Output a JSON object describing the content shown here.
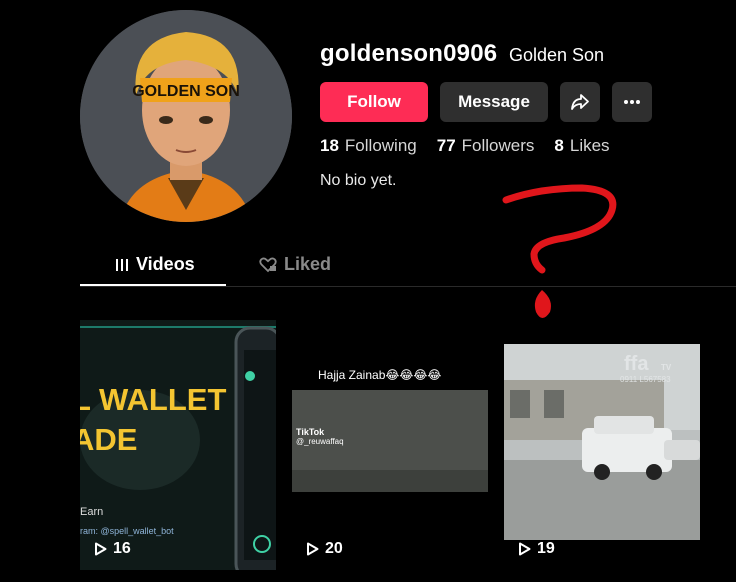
{
  "profile": {
    "username": "goldenson0906",
    "nickname": "Golden Son",
    "avatar_text": "GOLDEN SON",
    "bio": "No bio yet."
  },
  "actions": {
    "follow_label": "Follow",
    "message_label": "Message",
    "share_icon": "share-arrow-icon",
    "more_icon": "more-dots-icon"
  },
  "stats": [
    {
      "num": "18",
      "label": "Following"
    },
    {
      "num": "77",
      "label": "Followers"
    },
    {
      "num": "8",
      "label": "Likes"
    }
  ],
  "tabs": [
    {
      "label": "Videos",
      "icon": "grid-bars-icon",
      "active": true
    },
    {
      "label": "Liked",
      "icon": "heart-lock-icon",
      "active": false
    }
  ],
  "videos": [
    {
      "views": "16",
      "text_lines": [
        "L WALLET",
        "ADE"
      ],
      "earn": "Earn",
      "link": "ram: @spell_wallet_bot"
    },
    {
      "views": "20",
      "caption": "Hajja Zainab😂😂😂😂",
      "watermark": "TikTok",
      "watermark_handle": "@_reuwaffaq"
    },
    {
      "views": "19",
      "watermark": "ffa",
      "watermark_suffix": "TV",
      "watermark_number": "0911 L567583"
    }
  ],
  "colors": {
    "follow": "#fe2c55",
    "button_bg": "#2f2f2f",
    "annotation": "#e0161b"
  }
}
